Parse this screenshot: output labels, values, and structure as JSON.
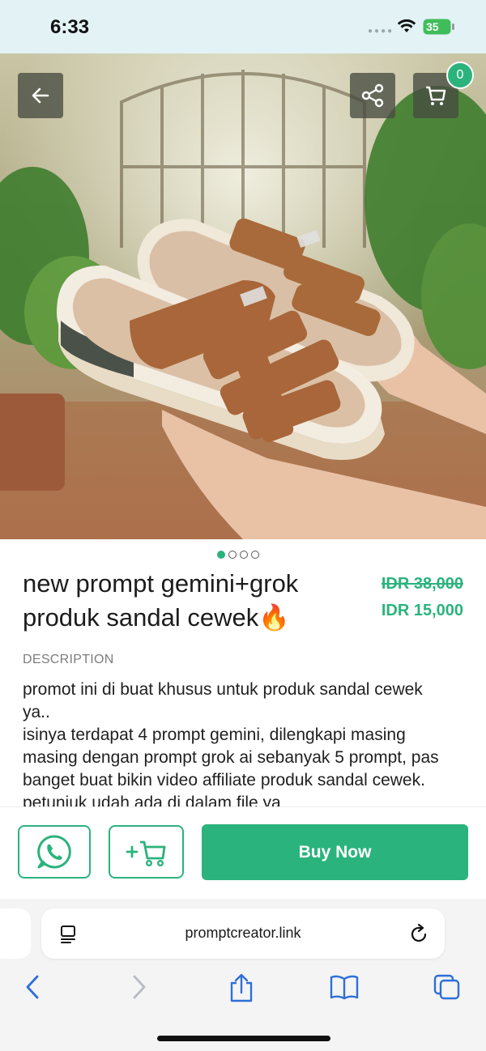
{
  "status_bar": {
    "time": "6:33",
    "battery": "35"
  },
  "header": {
    "cart_count": "0"
  },
  "gallery": {
    "pages": 4,
    "active": 0
  },
  "product": {
    "title_line1": "new prompt gemini+grok",
    "title_line2": "produk sandal cewek🔥",
    "old_price": "IDR 38,000",
    "price": "IDR 15,000"
  },
  "description": {
    "heading": "DESCRIPTION",
    "lines": [
      "promot ini di buat khusus untuk produk sandal cewek",
      "ya..",
      "isinya terdapat 4 prompt gemini, dilengkapi masing",
      "masing dengan prompt grok ai sebanyak 5 prompt, pas",
      "banget buat bikin video affiliate produk sandal cewek.",
      "petunjuk udah ada di dalam file ya"
    ]
  },
  "actions": {
    "buy_label": "Buy Now"
  },
  "browser": {
    "url": "promptcreator.link"
  },
  "colors": {
    "accent": "#2bb37d",
    "status_bg": "#e3f2f5"
  },
  "icons": [
    "back-arrow-icon",
    "share-icon",
    "cart-icon",
    "whatsapp-icon",
    "add-to-cart-icon",
    "reader-icon",
    "reload-icon",
    "nav-back-icon",
    "nav-forward-icon",
    "share-upload-icon",
    "bookmarks-icon",
    "tabs-icon"
  ]
}
